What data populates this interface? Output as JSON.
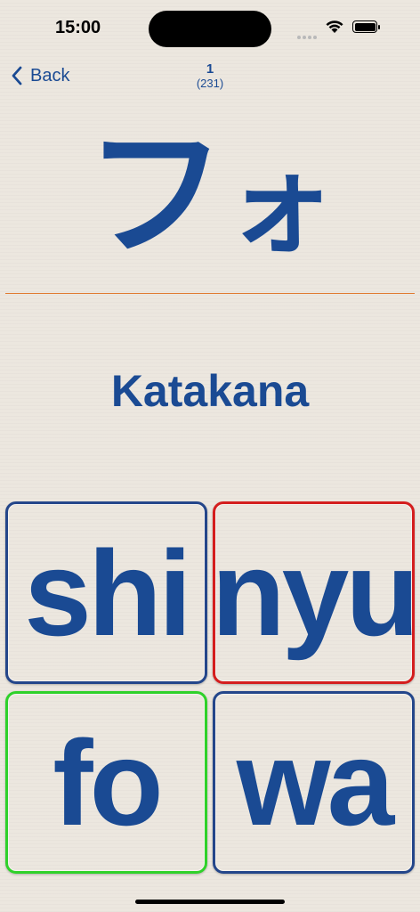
{
  "status_bar": {
    "time": "15:00"
  },
  "nav": {
    "back_label": "Back"
  },
  "counter": {
    "current": "1",
    "total": "(231)"
  },
  "card": {
    "kana_main": "フ",
    "kana_small": "ォ",
    "script": "Katakana"
  },
  "answers": [
    {
      "label": "shi",
      "state": "neutral",
      "border_color": "#24468a"
    },
    {
      "label": "nyu",
      "state": "wrong",
      "border_color": "#d41e1e"
    },
    {
      "label": "fo",
      "state": "correct",
      "border_color": "#2fd12a"
    },
    {
      "label": "wa",
      "state": "neutral",
      "border_color": "#24468a"
    }
  ],
  "colors": {
    "accent": "#1a4a93",
    "divider": "#e07a30",
    "background": "#ece7df"
  }
}
